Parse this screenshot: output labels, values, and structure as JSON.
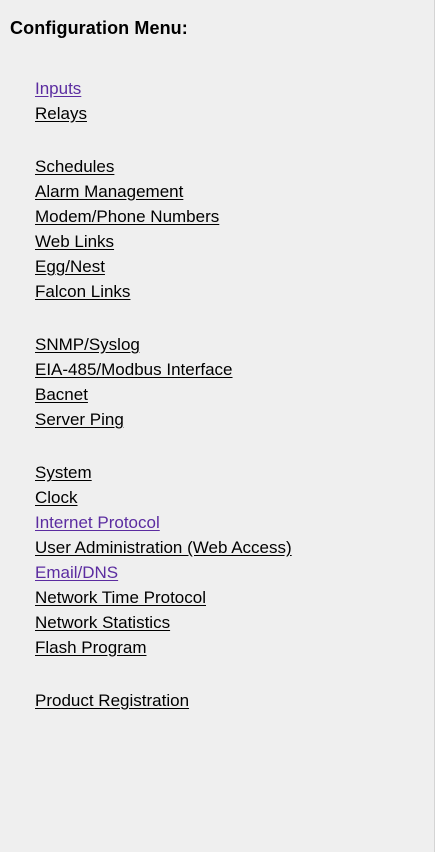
{
  "title": "Configuration Menu:",
  "menu": {
    "groups": [
      {
        "items": [
          {
            "label": "Inputs",
            "visited": true
          },
          {
            "label": "Relays",
            "visited": false
          }
        ]
      },
      {
        "items": [
          {
            "label": "Schedules",
            "visited": false
          },
          {
            "label": "Alarm Management",
            "visited": false
          },
          {
            "label": "Modem/Phone Numbers",
            "visited": false
          },
          {
            "label": "Web Links",
            "visited": false
          },
          {
            "label": "Egg/Nest",
            "visited": false
          },
          {
            "label": "Falcon Links",
            "visited": false
          }
        ]
      },
      {
        "items": [
          {
            "label": "SNMP/Syslog",
            "visited": false
          },
          {
            "label": "EIA-485/Modbus Interface",
            "visited": false
          },
          {
            "label": "Bacnet",
            "visited": false
          },
          {
            "label": "Server Ping",
            "visited": false
          }
        ]
      },
      {
        "items": [
          {
            "label": "System",
            "visited": false
          },
          {
            "label": "Clock",
            "visited": false
          },
          {
            "label": "Internet Protocol",
            "visited": true
          },
          {
            "label": "User Administration (Web Access)",
            "visited": false
          },
          {
            "label": "Email/DNS",
            "visited": true
          },
          {
            "label": "Network Time Protocol",
            "visited": false
          },
          {
            "label": "Network Statistics",
            "visited": false
          },
          {
            "label": "Flash Program",
            "visited": false
          }
        ]
      },
      {
        "items": [
          {
            "label": "Product Registration",
            "visited": false
          }
        ]
      }
    ]
  },
  "colors": {
    "panel_background": "#efefef",
    "link_text": "#000000",
    "visited_link": "#5b2ca0"
  }
}
